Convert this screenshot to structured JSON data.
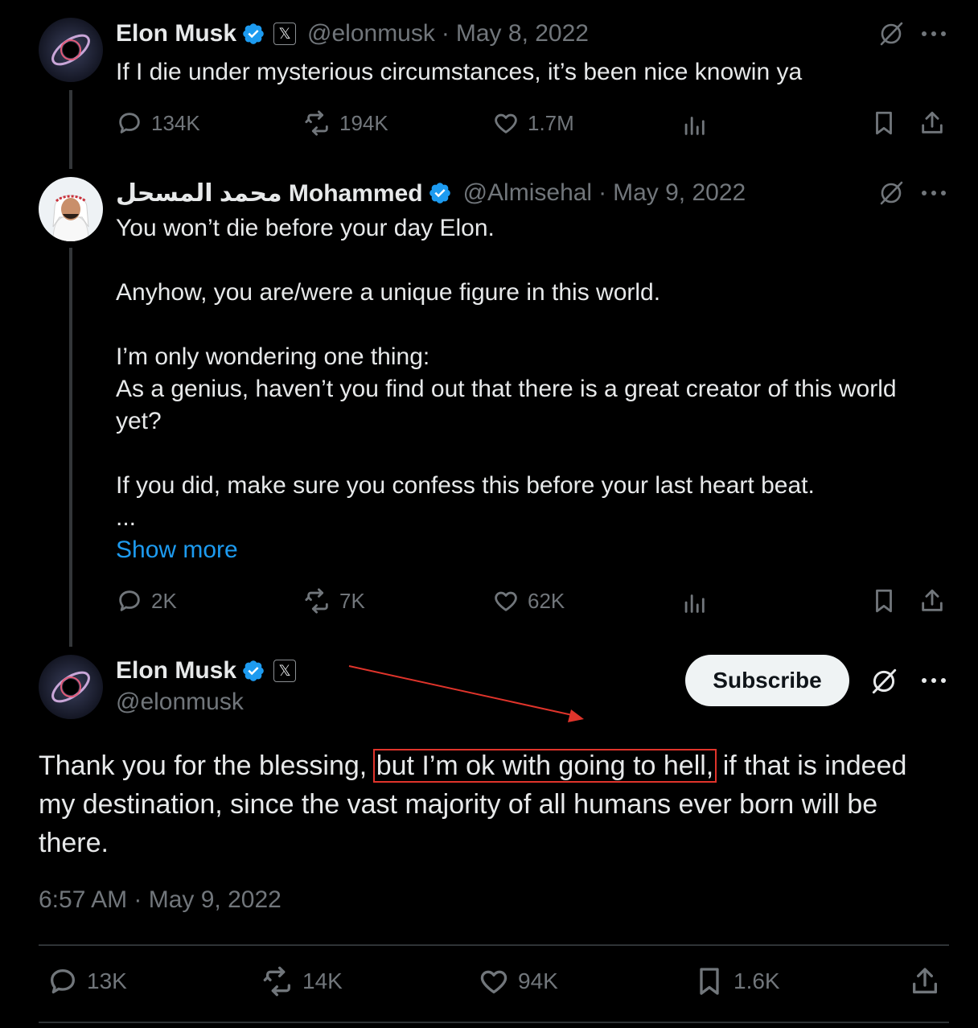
{
  "tweets": [
    {
      "name": "Elon Musk",
      "badge": "𝕏",
      "handle": "@elonmusk",
      "sep": "·",
      "date": "May 8, 2022",
      "text": "If I die under mysterious circumstances, it’s been nice knowin ya",
      "stats": {
        "replies": "134K",
        "retweets": "194K",
        "likes": "1.7M"
      }
    },
    {
      "name": "محمد المسحل Mohammed",
      "handle": "@Almisehal",
      "sep": "·",
      "date": "May 9, 2022",
      "lines": [
        "You won’t die before your day Elon.",
        "Anyhow, you are/were a unique figure in this world.",
        "I’m only wondering one thing:",
        "As a genius, haven’t you find out that there is a great creator of this world",
        "yet?",
        "If you did, make sure you confess this before your last heart beat.",
        "..."
      ],
      "show_more": "Show more",
      "stats": {
        "replies": "2K",
        "retweets": "7K",
        "likes": "62K"
      }
    }
  ],
  "main": {
    "name": "Elon Musk",
    "badge": "𝕏",
    "handle": "@elonmusk",
    "subscribe": "Subscribe",
    "text_before": "Thank you for the blessing,",
    "text_highlight": "but I’m ok with going to hell,",
    "text_after_line1": "if that is indeed",
    "text_line2": "my destination, since the vast majority of all humans ever born will be",
    "text_line3": "there.",
    "timestamp": "6:57 AM · May 9, 2022",
    "stats": {
      "replies": "13K",
      "retweets": "14K",
      "likes": "94K",
      "bookmarks": "1.6K"
    }
  },
  "colors": {
    "background": "#000000",
    "text": "#e7e9ea",
    "muted": "#71767b",
    "link": "#1d9bf0",
    "verified": "#1d9bf0",
    "annotation": "#e0342b"
  }
}
